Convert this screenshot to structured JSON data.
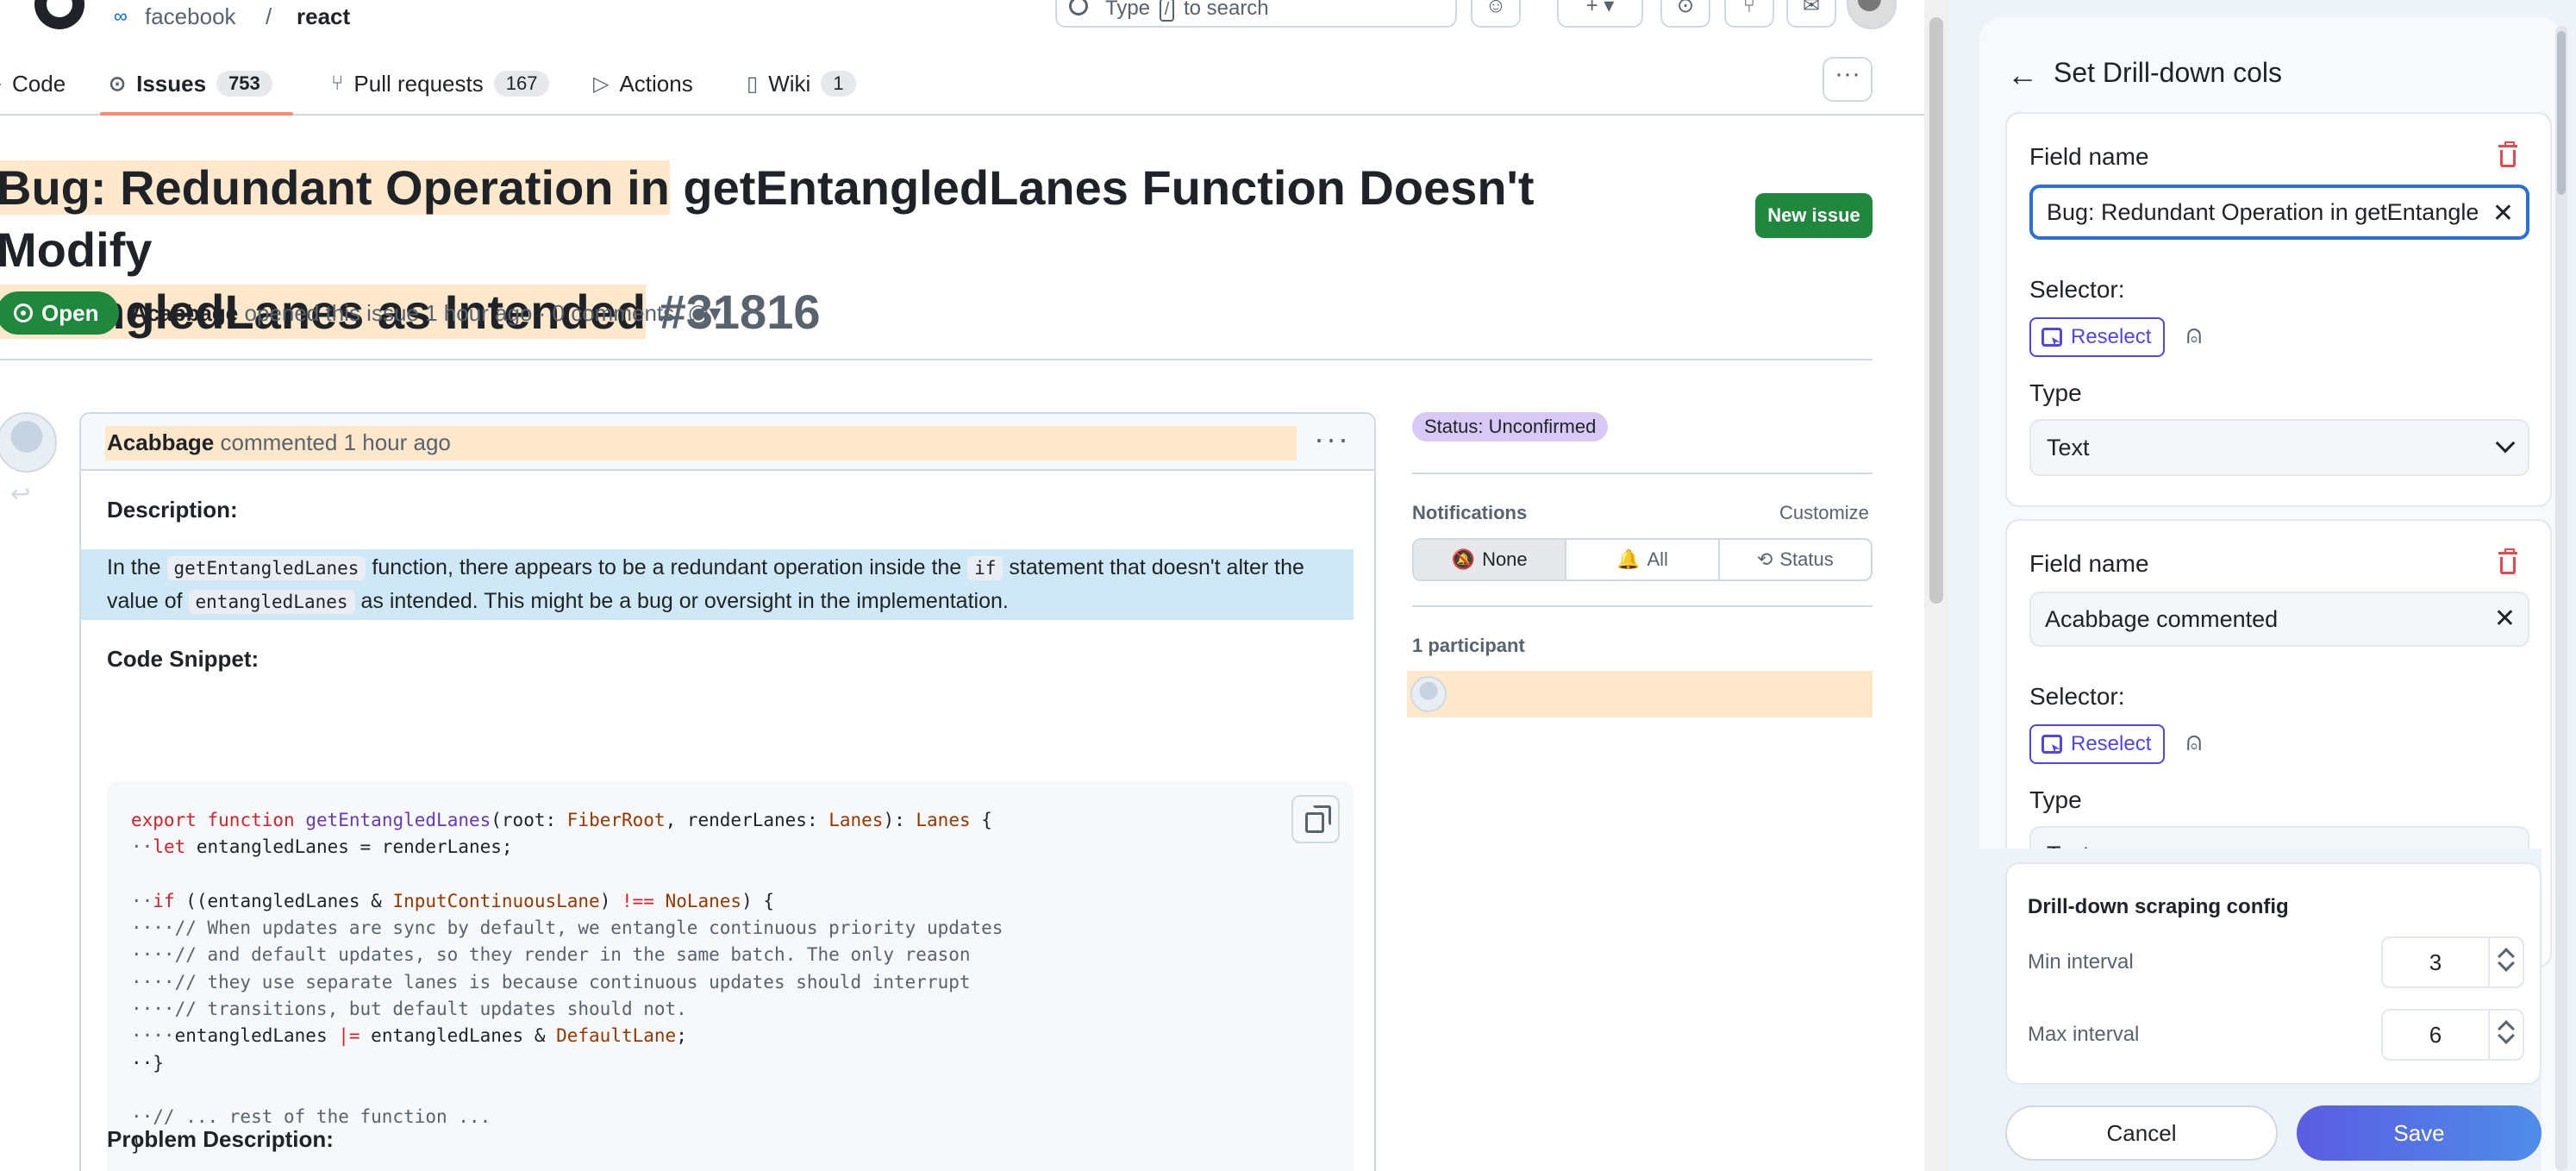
{
  "header": {
    "owner": "facebook",
    "separator": "/",
    "repo": "react",
    "search_placeholder_pre": "Type",
    "search_key": "/",
    "search_placeholder_post": "to search"
  },
  "tabs": [
    {
      "label": "Code",
      "icon": "code-icon"
    },
    {
      "label": "Issues",
      "count": "753",
      "icon": "issue-opened-icon"
    },
    {
      "label": "Pull requests",
      "count": "167",
      "icon": "git-pull-request-icon"
    },
    {
      "label": "Actions",
      "icon": "play-icon"
    },
    {
      "label": "Wiki",
      "count": "1",
      "icon": "book-icon"
    }
  ],
  "issue": {
    "title_highlighted": "Bug: Redundant Operation in",
    "title_rest": " getEntangledLanes Function Doesn't Modify ",
    "title_line2_highlighted": "entangledLanes as Intended",
    "number": "#31816",
    "new_issue_label": "New issue",
    "state": "Open",
    "author": "Acabbage",
    "meta_rest": "opened this issue 1 hour ago · 0 comments"
  },
  "comment": {
    "author": "Acabbage",
    "when": "commented 1 hour ago",
    "description_heading": "Description:",
    "desc_1": "In the ",
    "desc_code_1": "getEntangledLanes",
    "desc_2": " function, there appears to be a redundant operation inside the ",
    "desc_code_2": "if",
    "desc_3": " statement that doesn't alter the value of ",
    "desc_code_3": "entangledLanes",
    "desc_4": " as intended. This might be a bug or oversight in the implementation.",
    "snippet_heading": "Code Snippet:",
    "code": {
      "l1_export": "export",
      "l1_function": "function",
      "l1_name": "getEntangledLanes",
      "l1_open": "(root: ",
      "l1_type1": "FiberRoot",
      "l1_mid": ", renderLanes: ",
      "l1_type2": "Lanes",
      "l1_colon": "): ",
      "l1_type3": "Lanes",
      "l1_end": " {",
      "l2_indent": "··",
      "l2_let": "let",
      "l2_rest": " entangledLanes = renderLanes;",
      "l4_indent": "··",
      "l4_if": "if",
      "l4_a": " ((entangledLanes & ",
      "l4_type": "InputContinuousLane",
      "l4_b": ") ",
      "l4_op": "!==",
      "l4_c": " ",
      "l4_type2": "NoLanes",
      "l4_d": ") {",
      "l5": "····// When updates are sync by default, we entangle continuous priority updates",
      "l6": "····// and default updates, so they render in the same batch. The only reason",
      "l7": "····// they use separate lanes is because continuous updates should interrupt",
      "l8": "····// transitions, but default updates should not.",
      "l9_indent": "····",
      "l9_a": "entangledLanes ",
      "l9_op": "|=",
      "l9_b": " entangledLanes & ",
      "l9_type": "DefaultLane",
      "l9_c": ";",
      "l10": "··}",
      "l12": "··// ... rest of the function ...",
      "l13": "}"
    },
    "problem_heading": "Problem Description:"
  },
  "sidebar": {
    "status_label": "Status: Unconfirmed",
    "notifications_title": "Notifications",
    "customize": "Customize",
    "segments": [
      "None",
      "All",
      "Status"
    ],
    "participants_title": "1 participant"
  },
  "panel": {
    "title": "Set Drill-down cols",
    "fields": [
      {
        "field_name_label": "Field name",
        "value": "Bug: Redundant Operation in getEntangledLanes Function Doesn't Modify entangledLanes as Intended",
        "selector_label": "Selector:",
        "reselect_label": "Reselect",
        "type_label": "Type",
        "type_value": "Text"
      },
      {
        "field_name_label": "Field name",
        "value": "Acabbage commented",
        "selector_label": "Selector:",
        "reselect_label": "Reselect",
        "type_label": "Type",
        "type_value": "Text"
      }
    ],
    "config": {
      "title": "Drill-down scraping config",
      "min_label": "Min interval",
      "min_value": "3",
      "max_label": "Max interval",
      "max_value": "6"
    },
    "cancel_label": "Cancel",
    "save_label": "Save"
  },
  "colors": {
    "accent_green": "#1f883d",
    "highlight_orange": "#fde8cc",
    "highlight_blue": "#cfe8f6",
    "panel_primary": "#4f46e5",
    "danger": "#e5484d"
  }
}
